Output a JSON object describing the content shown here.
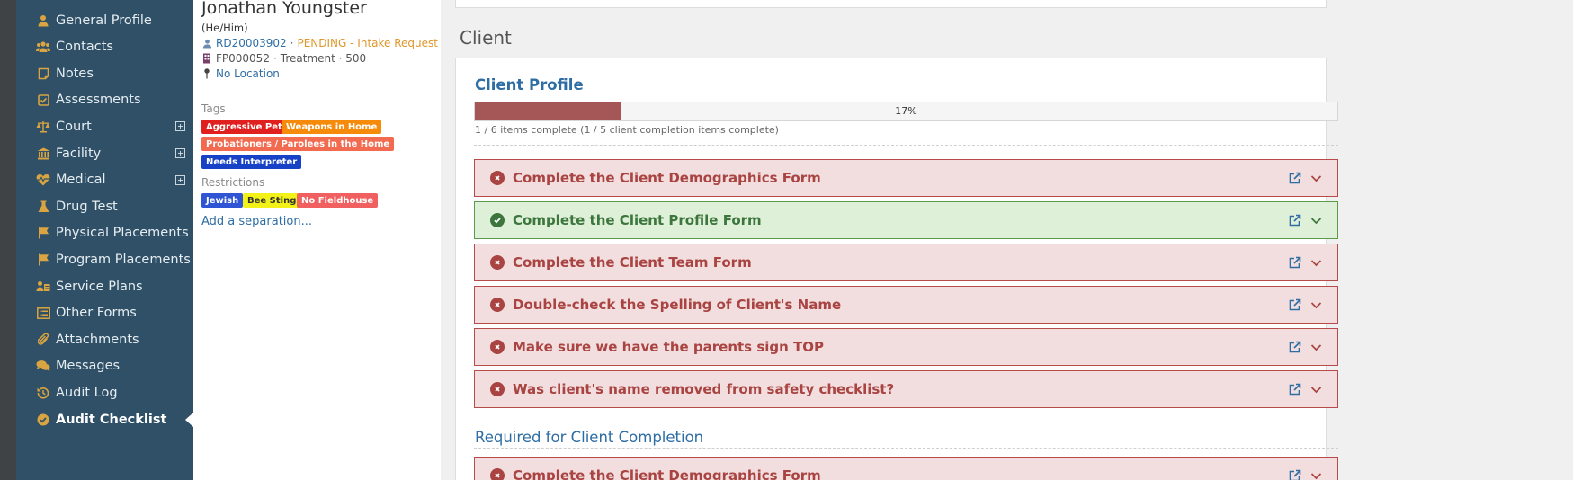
{
  "sidebar": {
    "items": [
      {
        "label": "General Profile",
        "icon": "user-icon",
        "expandable": false
      },
      {
        "label": "Contacts",
        "icon": "users-icon",
        "expandable": false
      },
      {
        "label": "Notes",
        "icon": "note-icon",
        "expandable": false
      },
      {
        "label": "Assessments",
        "icon": "checkbox-icon",
        "expandable": false
      },
      {
        "label": "Court",
        "icon": "scales-icon",
        "expandable": true
      },
      {
        "label": "Facility",
        "icon": "building-icon",
        "expandable": true
      },
      {
        "label": "Medical",
        "icon": "heartbeat-icon",
        "expandable": true
      },
      {
        "label": "Drug Test",
        "icon": "flask-icon",
        "expandable": false
      },
      {
        "label": "Physical Placements",
        "icon": "flag-icon",
        "expandable": false
      },
      {
        "label": "Program Placements",
        "icon": "flag-icon",
        "expandable": false
      },
      {
        "label": "Service Plans",
        "icon": "service-icon",
        "expandable": false
      },
      {
        "label": "Other Forms",
        "icon": "list-icon",
        "expandable": false
      },
      {
        "label": "Attachments",
        "icon": "paperclip-icon",
        "expandable": false
      },
      {
        "label": "Messages",
        "icon": "comments-icon",
        "expandable": false
      },
      {
        "label": "Audit Log",
        "icon": "history-icon",
        "expandable": false
      },
      {
        "label": "Audit Checklist",
        "icon": "check-circle-icon",
        "expandable": false,
        "active": true
      }
    ]
  },
  "client": {
    "name": "Jonathan Youngster",
    "pronouns": "(He/Him)",
    "record_id": "RD20003902",
    "separator": "·",
    "status": "PENDING - Intake Request",
    "facility_id": "FP000052",
    "facility_detail": "Treatment · 500",
    "location": "No Location",
    "tags_label": "Tags",
    "tags": [
      {
        "label": "Aggressive Pets",
        "color": "#e0201f"
      },
      {
        "label": "Weapons in Home",
        "color": "#f58a0b"
      },
      {
        "label": "Probationers / Parolees in the Home",
        "color": "#f26a4f"
      },
      {
        "label": "Needs Interpreter",
        "color": "#1742c7"
      }
    ],
    "restrictions_label": "Restrictions",
    "restrictions": [
      {
        "label": "Jewish",
        "color": "#2f55d4",
        "text_color": "#ffffff"
      },
      {
        "label": "Bee Sting",
        "color": "#f2f218",
        "text_color": "#333333"
      },
      {
        "label": "No Fieldhouse",
        "color": "#f06060",
        "text_color": "#ffffff"
      }
    ],
    "add_separation": "Add a separation..."
  },
  "main": {
    "section_title": "Client",
    "card_title": "Client Profile",
    "progress": {
      "percent": 17,
      "label": "17%",
      "caption": "1 / 6 items complete (1 / 5 client completion items complete)"
    },
    "items": [
      {
        "label": "Complete the Client Demographics Form",
        "status": "fail"
      },
      {
        "label": "Complete the Client Profile Form",
        "status": "pass"
      },
      {
        "label": "Complete the Client Team Form",
        "status": "fail"
      },
      {
        "label": "Double-check the Spelling of Client's Name",
        "status": "fail"
      },
      {
        "label": "Make sure we have the parents sign TOP",
        "status": "fail"
      },
      {
        "label": "Was client's name removed from safety checklist?",
        "status": "fail"
      }
    ],
    "required_heading": "Required for Client Completion",
    "required_items": [
      {
        "label": "Complete the Client Demographics Form",
        "status": "fail"
      }
    ]
  },
  "colors": {
    "sidebar_bg": "#2f5066",
    "icon_gold": "#d9a441",
    "link": "#2e6da4",
    "fail_bg": "#f2dede",
    "pass_bg": "#dff0d8",
    "progress_fill": "#a55656"
  }
}
